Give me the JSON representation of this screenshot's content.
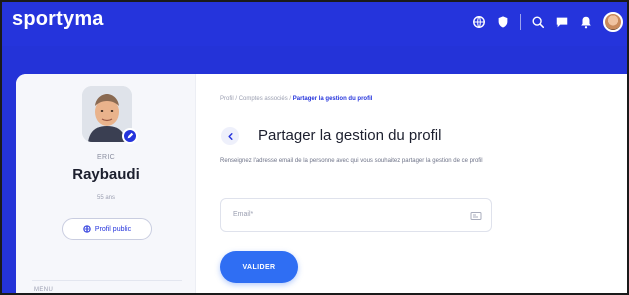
{
  "app": {
    "logo": "sportyma"
  },
  "topbar": {
    "icons": [
      "globe-icon",
      "shield-icon",
      "search-icon",
      "chat-icon",
      "bell-icon",
      "user-avatar"
    ]
  },
  "profile": {
    "first_name": "ERIC",
    "last_name": "Raybaudi",
    "age": "55 ans",
    "public_profile_label": "Profil public"
  },
  "sidebar": {
    "section_label": "MENU"
  },
  "breadcrumb": {
    "items": [
      "Profil",
      "Comptes associés",
      "Partager la gestion du profil"
    ],
    "separator": " / "
  },
  "main": {
    "title": "Partager la gestion du profil",
    "description": "Renseignez l'adresse email de la personne avec qui vous souhaitez partager la gestion de ce profil"
  },
  "form": {
    "email_placeholder": "Email*",
    "submit_label": "VALIDER"
  },
  "colors": {
    "brand": "#2534dc",
    "button": "#2f6ef3"
  }
}
